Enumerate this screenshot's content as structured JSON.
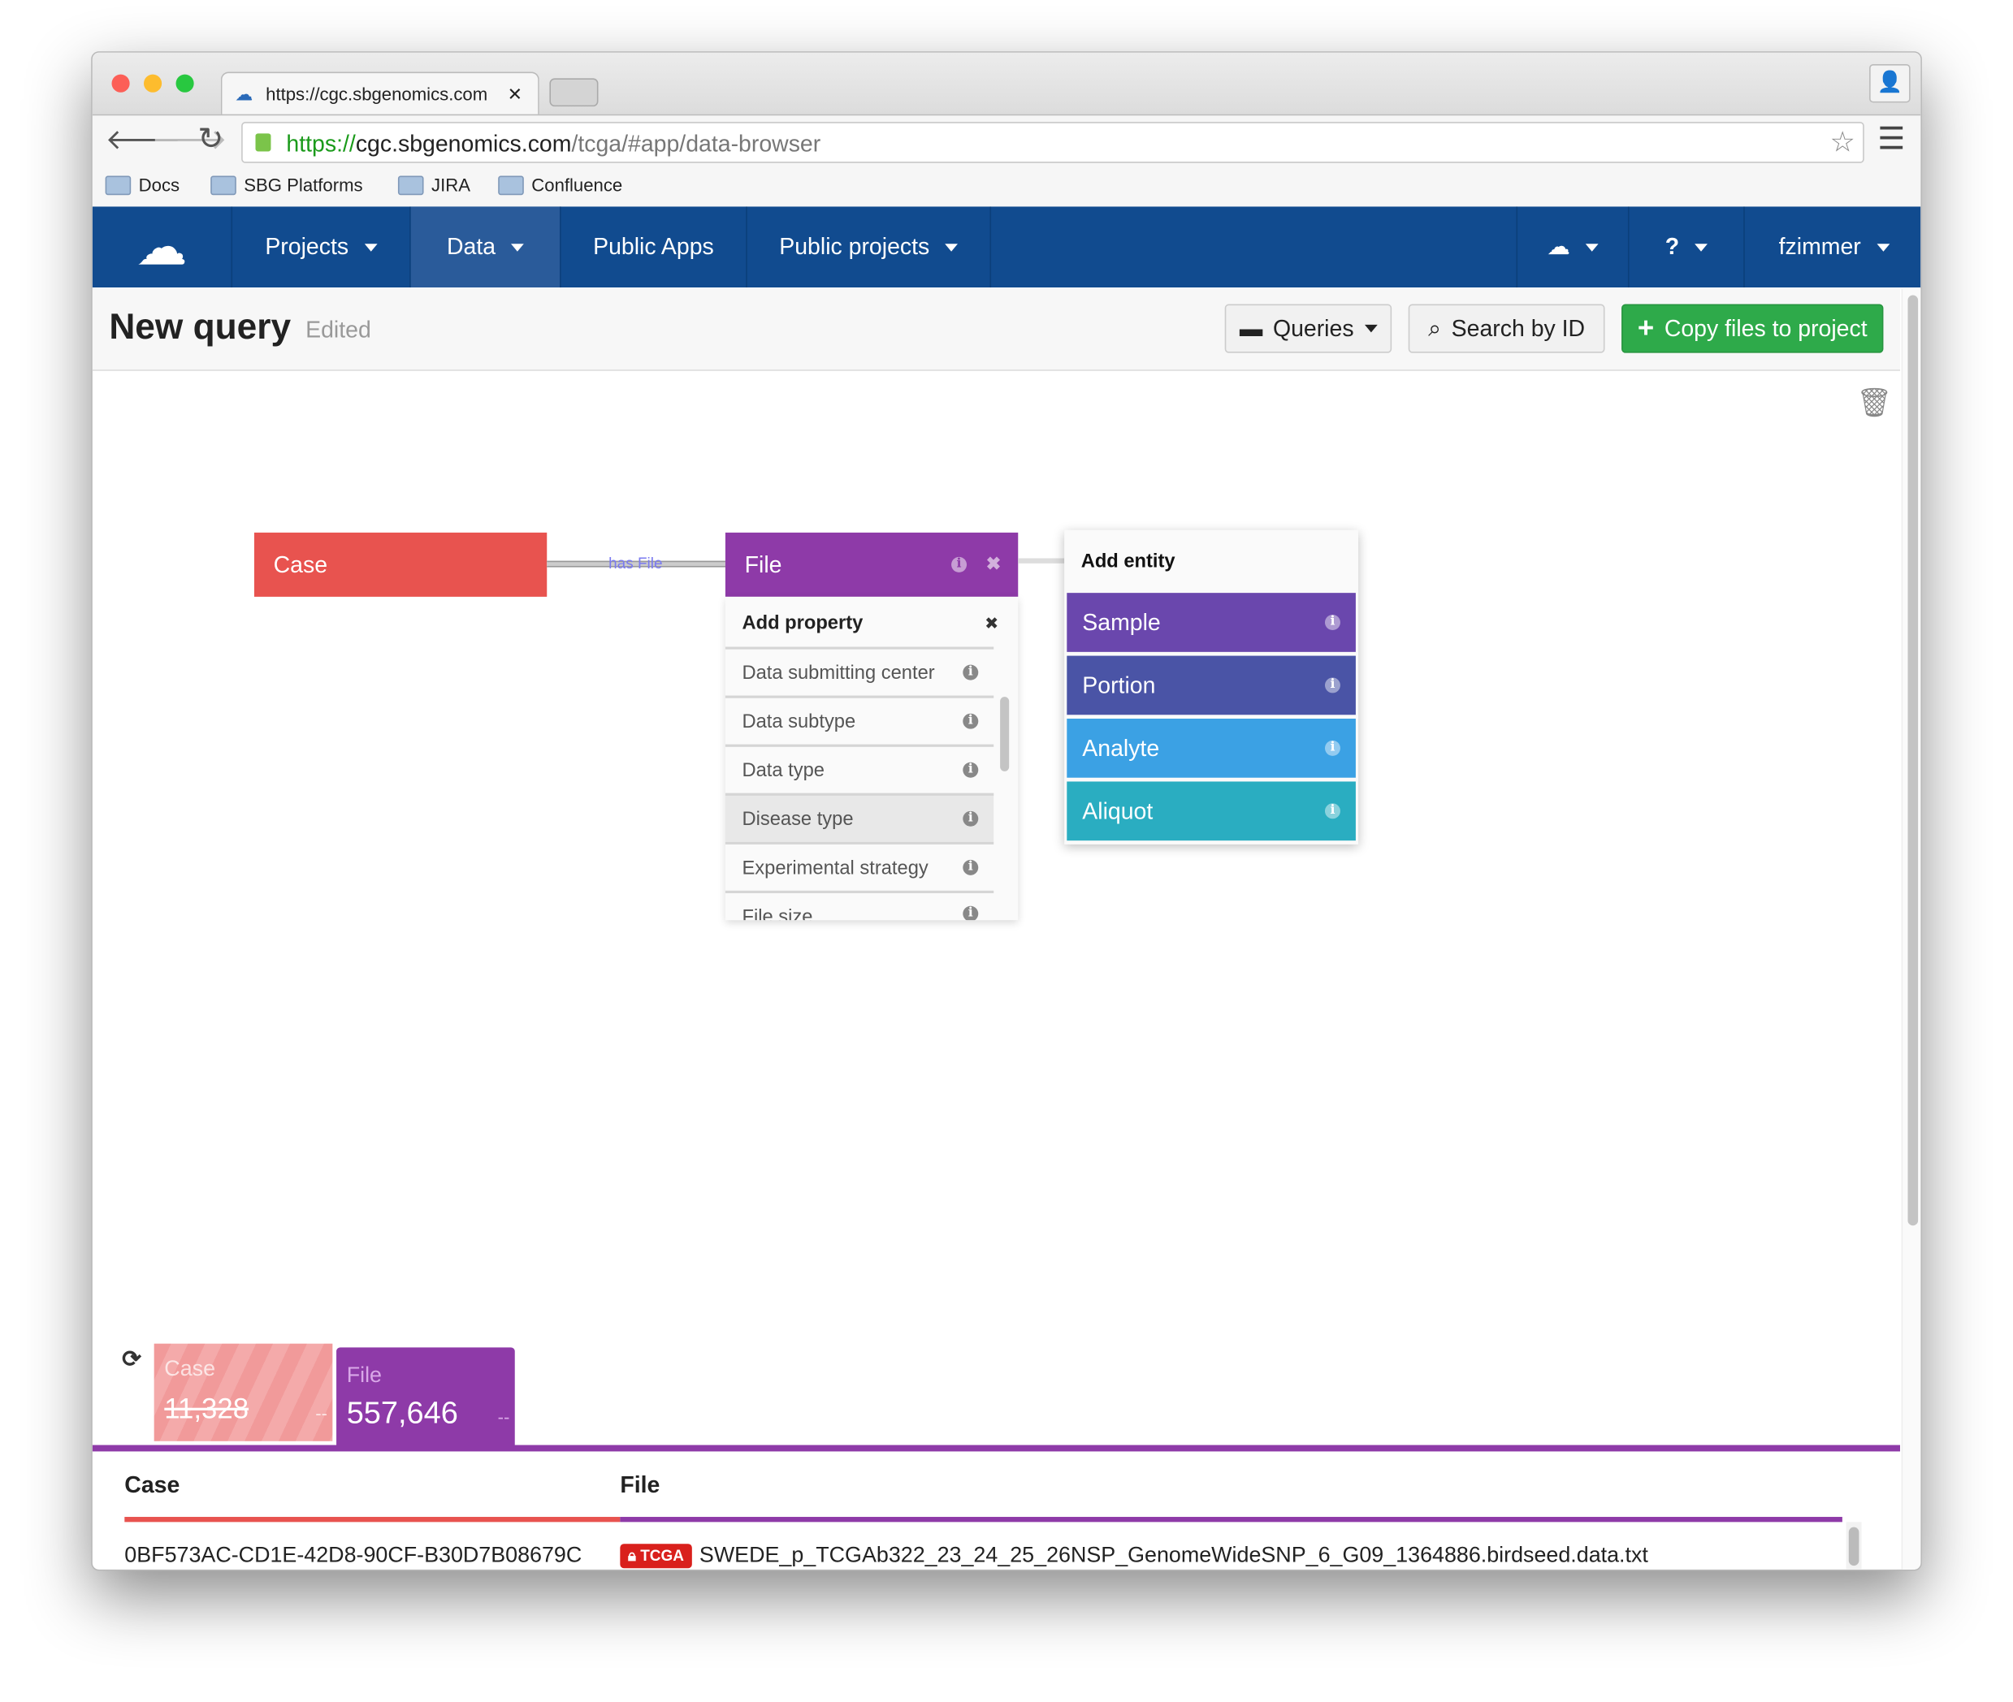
{
  "browser": {
    "tab_title": "https://cgc.sbgenomics.com",
    "url_scheme": "https://",
    "url_host": "cgc.sbgenomics.com",
    "url_path": "/tcga/#app/data-browser",
    "bookmarks": [
      "Docs",
      "SBG Platforms",
      "JIRA",
      "Confluence"
    ]
  },
  "nav": {
    "items": [
      {
        "label": "Projects"
      },
      {
        "label": "Data"
      },
      {
        "label": "Public Apps"
      },
      {
        "label": "Public projects"
      }
    ],
    "user": "fzimmer",
    "active": "Data",
    "color": "#114b8f"
  },
  "header": {
    "title": "New query",
    "status": "Edited",
    "queries_label": "Queries",
    "search_label": "Search by ID",
    "copy_label": "Copy files to project"
  },
  "graph": {
    "case_label": "Case",
    "edge_label": "has File",
    "file_label": "File",
    "add_property": {
      "title": "Add property",
      "items": [
        "Data submitting center",
        "Data subtype",
        "Data type",
        "Disease type",
        "Experimental strategy",
        "File size"
      ]
    },
    "add_entity": {
      "title": "Add entity",
      "items": [
        "Sample",
        "Portion",
        "Analyte",
        "Aliquot"
      ]
    }
  },
  "counts": {
    "case": {
      "label": "Case",
      "value": "11,328",
      "extra": "--"
    },
    "file": {
      "label": "File",
      "value": "557,646",
      "extra": "--"
    }
  },
  "table": {
    "columns": [
      "Case",
      "File"
    ],
    "rows": [
      {
        "case": "0BF573AC-CD1E-42D8-90CF-B30D7B08679C",
        "badge": "TCGA",
        "file": "SWEDE_p_TCGAb322_23_24_25_26NSP_GenomeWideSNP_6_G09_1364886.birdseed.data.txt"
      }
    ]
  },
  "colors": {
    "case": "#e8534f",
    "file": "#8e3aa8",
    "sample": "#6a47ad",
    "portion": "#4a54a6",
    "analyte": "#3ba1e4",
    "aliquot": "#2aadc1",
    "copy_button": "#2eaa4a"
  }
}
